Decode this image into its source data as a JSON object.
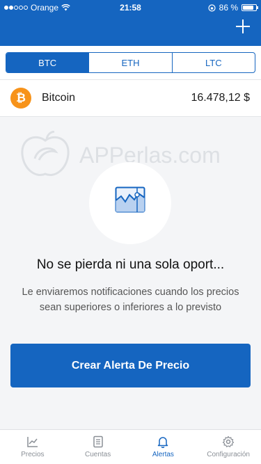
{
  "status_bar": {
    "carrier": "Orange",
    "time": "21:58",
    "battery_text": "86 %",
    "battery_level": 0.86
  },
  "header": {
    "add_icon": "plus-icon"
  },
  "segments": [
    {
      "label": "BTC",
      "active": true
    },
    {
      "label": "ETH",
      "active": false
    },
    {
      "label": "LTC",
      "active": false
    }
  ],
  "coin": {
    "symbol": "₿",
    "name": "Bitcoin",
    "price": "16.478,12 $"
  },
  "watermark": {
    "text": "APPerlas.com"
  },
  "empty_state": {
    "icon": "chart-window-icon",
    "title": "No se pierda ni una sola oport...",
    "description": "Le enviaremos notificaciones cuando los precios sean superiores o inferiores a lo previsto"
  },
  "cta": {
    "label": "Crear Alerta De Precio"
  },
  "tabbar": [
    {
      "label": "Precios",
      "icon": "chart-icon",
      "active": false
    },
    {
      "label": "Cuentas",
      "icon": "document-icon",
      "active": false
    },
    {
      "label": "Alertas",
      "icon": "bell-icon",
      "active": true
    },
    {
      "label": "Configuración",
      "icon": "gear-icon",
      "active": false
    }
  ],
  "colors": {
    "accent": "#1565c0",
    "bitcoin": "#f7931a",
    "background": "#f4f5f7"
  }
}
